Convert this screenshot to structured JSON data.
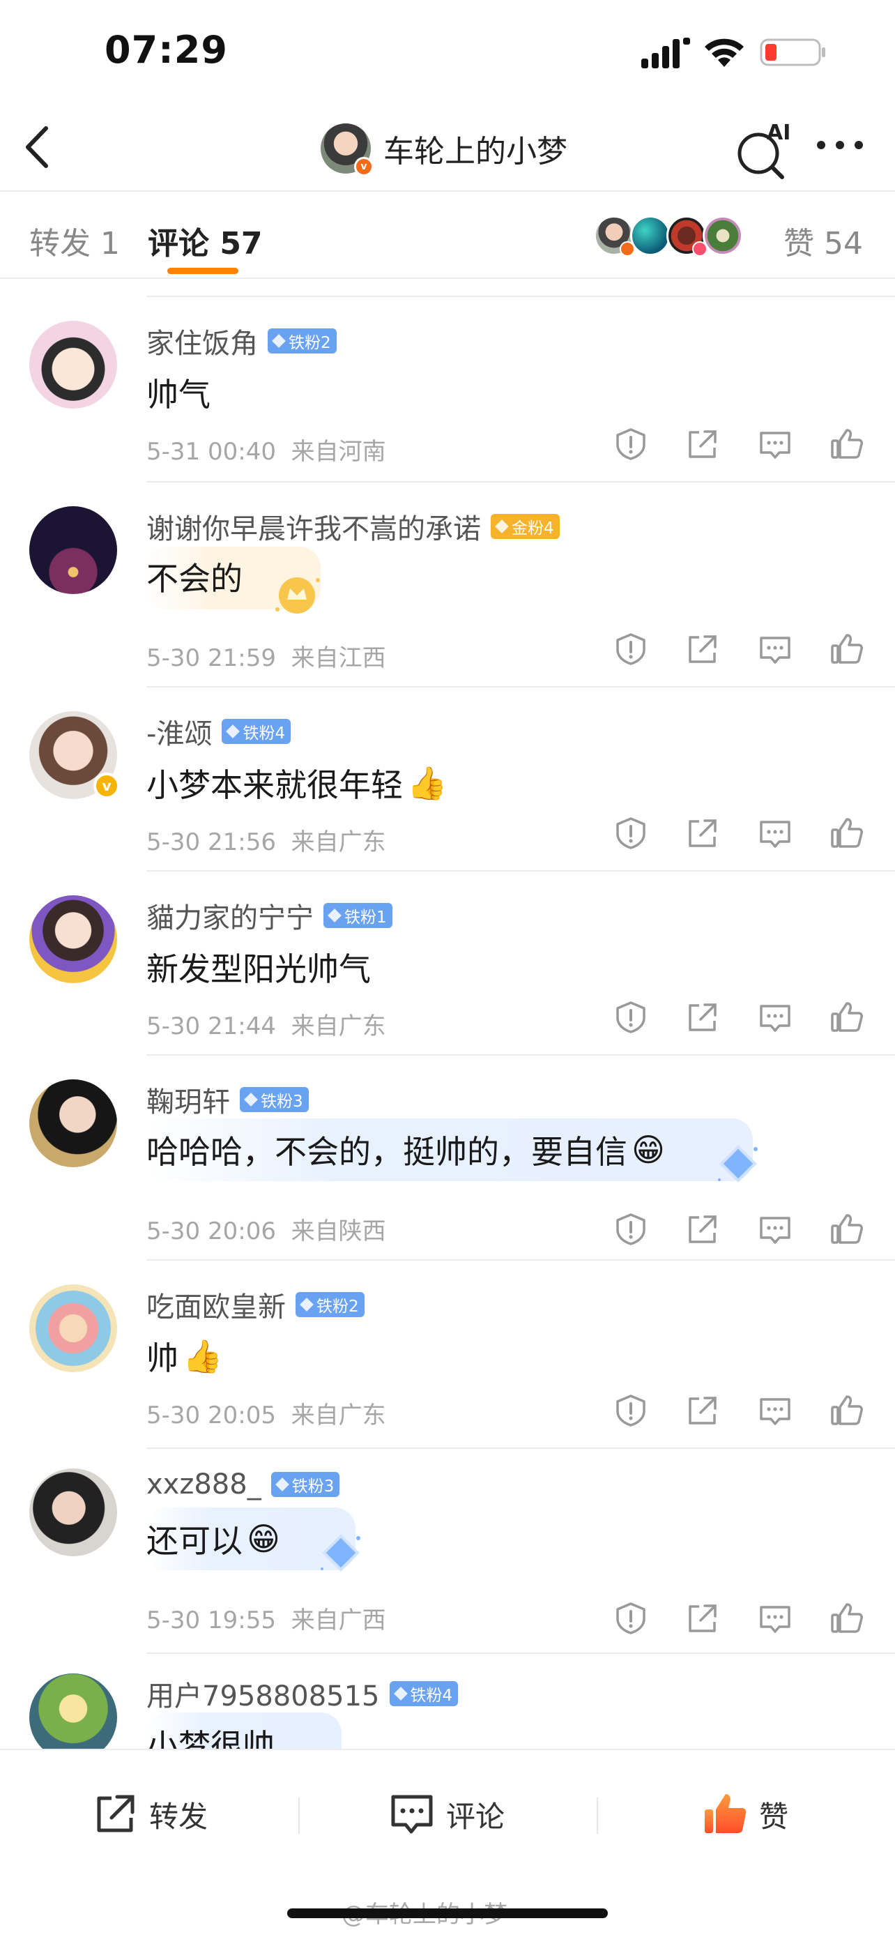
{
  "status": {
    "time": "07:29"
  },
  "nav": {
    "title": "车轮上的小梦",
    "ai_label": "AI"
  },
  "tabs": {
    "repost": "转发 1",
    "comment": "评论 57",
    "like": "赞 54"
  },
  "comments": [
    {
      "name": "家住饭角",
      "badge": "铁粉2",
      "badge_type": "iron",
      "text": "帅气",
      "emoji": "",
      "time": "5-31 00:40",
      "location": "来自河南"
    },
    {
      "name": "谢谢你早晨许我不嵩的承诺",
      "badge": "金粉4",
      "badge_type": "gold",
      "text": "不会的",
      "emoji": "",
      "time": "5-30 21:59",
      "location": "来自江西"
    },
    {
      "name": "-淮颂",
      "badge": "铁粉4",
      "badge_type": "iron",
      "text": "小梦本来就很年轻",
      "emoji": "👍",
      "time": "5-30 21:56",
      "location": "来自广东"
    },
    {
      "name": "貓力家的宁宁",
      "badge": "铁粉1",
      "badge_type": "iron",
      "text": "新发型阳光帅气",
      "emoji": "",
      "time": "5-30 21:44",
      "location": "来自广东"
    },
    {
      "name": "鞠玥轩",
      "badge": "铁粉3",
      "badge_type": "iron",
      "text": "哈哈哈，不会的，挺帅的，要自信",
      "emoji": "😁",
      "time": "5-30 20:06",
      "location": "来自陕西"
    },
    {
      "name": "吃面欧皇新",
      "badge": "铁粉2",
      "badge_type": "iron",
      "text": "帅",
      "emoji": "👍",
      "time": "5-30 20:05",
      "location": "来自广东"
    },
    {
      "name": "xxz888_",
      "badge": "铁粉3",
      "badge_type": "iron",
      "text": "还可以",
      "emoji": "😁",
      "time": "5-30 19:55",
      "location": "来自广西"
    },
    {
      "name": "用户7958808515",
      "badge": "铁粉4",
      "badge_type": "iron",
      "text": "小梦很帅",
      "emoji": "",
      "time": "",
      "location": ""
    }
  ],
  "bottom": {
    "repost": "转发",
    "comment": "评论",
    "like": "赞"
  },
  "watermark": "@车轮上的小梦",
  "colors": {
    "accent": "#ff8200",
    "iron_badge": "#6aa2f2",
    "gold_badge": "#f5b22a",
    "like_active": "#ff6a2a"
  }
}
